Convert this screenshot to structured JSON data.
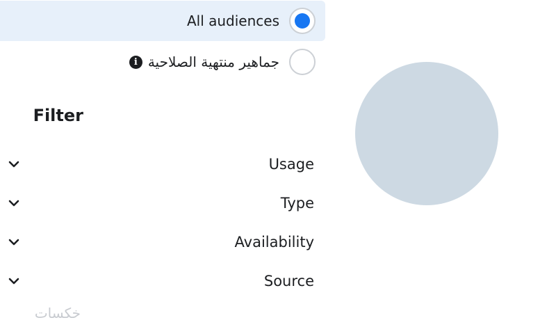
{
  "audiences": {
    "all_label": "All audiences",
    "expired_label": "جماهير منتهية الصلاحية",
    "selected": "all"
  },
  "filter": {
    "title": "Filter",
    "items": [
      {
        "label": "Usage"
      },
      {
        "label": "Type"
      },
      {
        "label": "Availability"
      },
      {
        "label": "Source"
      }
    ],
    "partial_label": "خكسات"
  },
  "colors": {
    "accent": "#1877f2",
    "selected_bg": "#e7f0fa",
    "avatar_placeholder": "#cdd9e3"
  },
  "icons": {
    "info": "info-icon",
    "chevron": "chevron-down-icon"
  }
}
